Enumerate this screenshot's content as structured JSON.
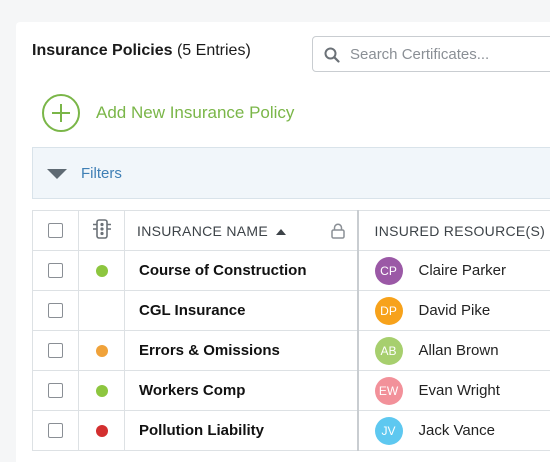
{
  "header": {
    "title": "Insurance Policies",
    "count_label": "(5 Entries)"
  },
  "search": {
    "placeholder": "Search Certificates..."
  },
  "add_button": {
    "label": "Add New Insurance Policy"
  },
  "filters": {
    "label": "Filters"
  },
  "table": {
    "columns": {
      "name": "INSURANCE NAME",
      "resources": "INSURED RESOURCE(S)"
    },
    "rows": [
      {
        "status_color": "#8dc63f",
        "name": "Course of Construction",
        "initials": "CP",
        "avatar_color": "#9b59a6",
        "resource": "Claire Parker"
      },
      {
        "status_color": "",
        "name": "CGL Insurance",
        "initials": "DP",
        "avatar_color": "#f7a21b",
        "resource": "David Pike"
      },
      {
        "status_color": "#f0a23a",
        "name": "Errors & Omissions",
        "initials": "AB",
        "avatar_color": "#a7cf6e",
        "resource": "Allan Brown"
      },
      {
        "status_color": "#8dc63f",
        "name": "Workers Comp",
        "initials": "EW",
        "avatar_color": "#f2919a",
        "resource": "Evan Wright"
      },
      {
        "status_color": "#d32f2f",
        "name": "Pollution Liability",
        "initials": "JV",
        "avatar_color": "#5ec8f0",
        "resource": "Jack Vance"
      }
    ]
  }
}
